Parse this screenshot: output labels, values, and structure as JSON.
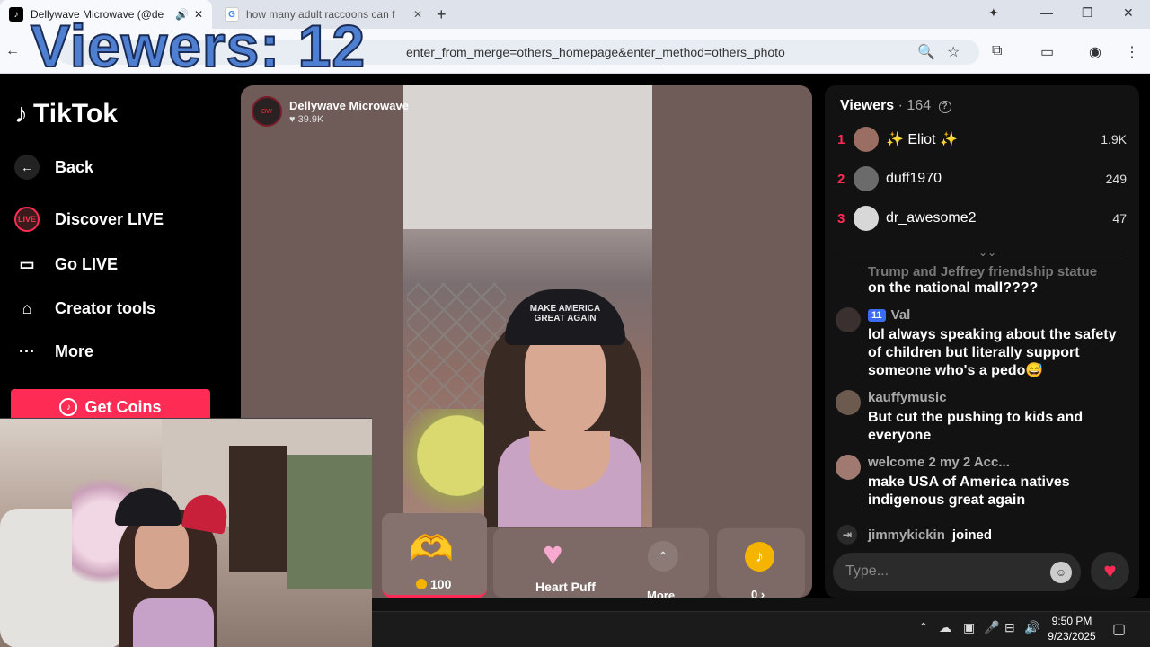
{
  "browser": {
    "tabs": [
      {
        "title": "Dellywave Microwave (@de",
        "favicon": "T",
        "active": true
      },
      {
        "title": "how many adult raccoons can f",
        "favicon": "G",
        "active": false
      }
    ],
    "url": "co  m/@de...ertoy...ive?enter_from_merge=others_homepage&enter_method=others_photo",
    "url_visible": "enter_from_merge=others_homepage&enter_method=others_photo"
  },
  "overlay": {
    "viewers_text": "Viewers: 12"
  },
  "sidebar": {
    "logo": "TikTok",
    "items": [
      {
        "label": "Back",
        "icon": "back-arrow-icon"
      },
      {
        "label": "Discover LIVE",
        "icon": "live-avatar-icon"
      },
      {
        "label": "Go LIVE",
        "icon": "camera-icon"
      },
      {
        "label": "Creator tools",
        "icon": "creator-tools-icon"
      },
      {
        "label": "More",
        "icon": "more-dots-icon"
      }
    ],
    "get_coins": "Get Coins"
  },
  "stream": {
    "host_name": "Dellywave Microwave",
    "host_likes": "♥ 39.9K",
    "hat_text": "MAKE AMERICA GREAT AGAIN"
  },
  "gifts": {
    "gift1_price": "100",
    "gift2_label": "Heart Puff",
    "more_label": "More",
    "coins_label": "0 ›"
  },
  "viewers_panel": {
    "title": "Viewers",
    "count": "· 164",
    "top": [
      {
        "rank": "1",
        "name": "✨ Eliot ✨",
        "score": "1.9K"
      },
      {
        "rank": "2",
        "name": "duff1970",
        "score": "249"
      },
      {
        "rank": "3",
        "name": "dr_awesome2",
        "score": "47"
      }
    ]
  },
  "chat": {
    "partial_text": "Trump and Jeffrey friendship statue",
    "partial_text2": "on the national mall????",
    "messages": [
      {
        "badge": "11",
        "user": "Val",
        "text": "lol always speaking about the safety of children but literally support someone who's a pedo😅"
      },
      {
        "user": "kauffymusic",
        "text": "But cut the pushing to kids and everyone"
      },
      {
        "user": "welcome 2 my 2 Acc...",
        "text": "make USA of America natives indigenous great again"
      }
    ],
    "join_user": "jimmykickin",
    "join_text": "joined",
    "input_placeholder": "Type..."
  },
  "taskbar": {
    "time": "9:50 PM",
    "date": "9/23/2025"
  },
  "colors": {
    "accent": "#fe2c55",
    "overlay_text": "#4e7fd0",
    "panel_bg": "#121212"
  }
}
